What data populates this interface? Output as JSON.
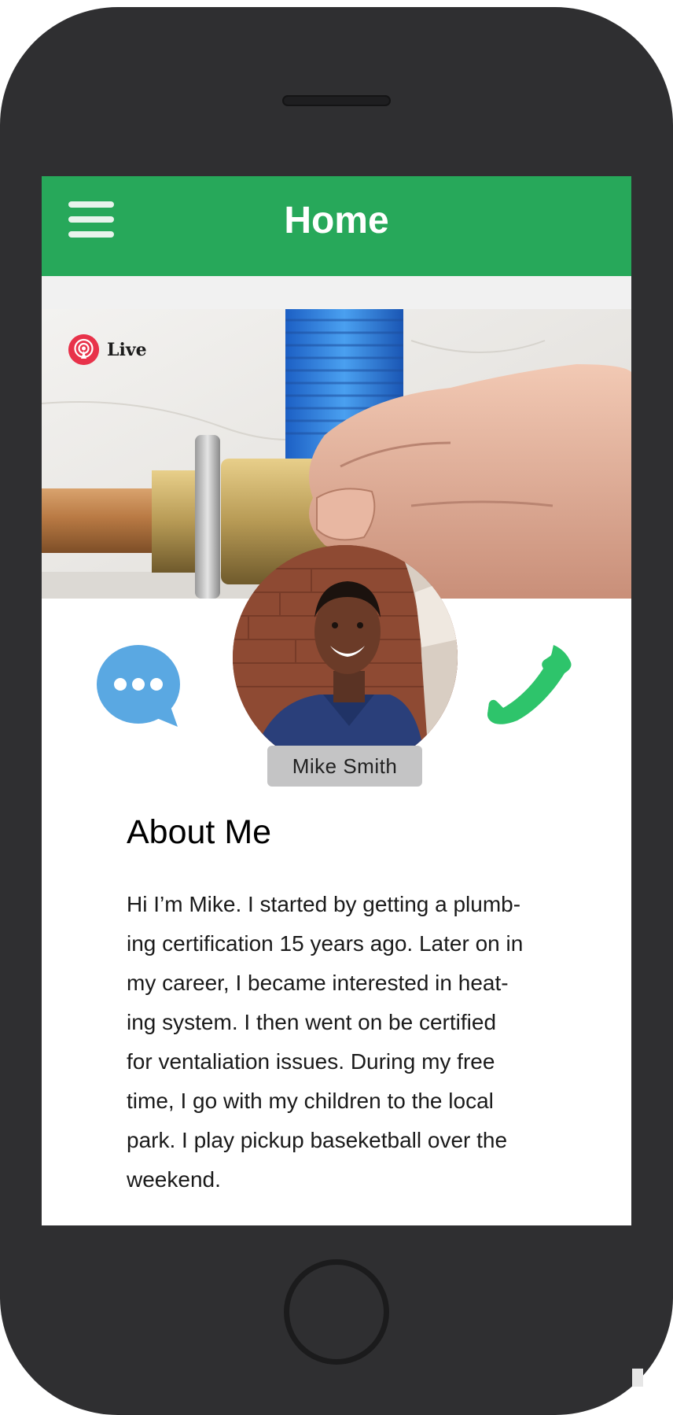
{
  "header": {
    "title": "Home",
    "menu_icon": "hamburger-menu-icon"
  },
  "banner": {
    "live_label": "Live",
    "live_icon": "broadcast-icon",
    "image_description_icon": "plumbing-pipe-photo"
  },
  "profile": {
    "name": "Mike Smith",
    "chat_icon": "chat-bubble-icon",
    "call_icon": "phone-icon"
  },
  "about": {
    "title": "About Me",
    "lines": [
      "Hi I’m Mike. I started by getting a plumb-",
      "ing certification 15 years ago. Later on in",
      "my career, I became interested in heat-",
      "ing system. I then went on be certified",
      "for ventaliation issues. During my free",
      "time, I go with my children to the local",
      "park. I play pickup baseketball over the",
      "weekend."
    ]
  },
  "colors": {
    "header_green": "#27a85a",
    "chat_blue": "#5aa8e2",
    "call_green": "#2ec46b",
    "live_red": "#e8324a",
    "phone_body": "#2f2f31"
  }
}
